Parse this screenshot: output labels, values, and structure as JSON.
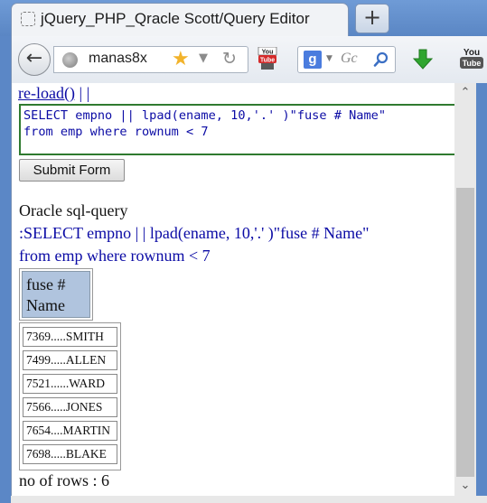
{
  "tab": {
    "title": "jQuery_PHP_Qracle Scott/Query Editor",
    "new_tab_label": "+"
  },
  "nav": {
    "url": "manas8x",
    "search_placeholder": "Gc",
    "back_icon": "back-arrow-icon",
    "search_engine_icon": "google-icon",
    "search_engine_letter": "g"
  },
  "page": {
    "reload_link": "re-load()",
    "reload_suffix": " | |",
    "query_line_1": "SELECT empno || lpad(ename, 10,'.' )\"fuse # Name\"",
    "query_line_2": "from emp where rownum < 7",
    "submit_label": "Submit Form",
    "heading": "Oracle sql-query",
    "echo_line_1": ":SELECT empno | | lpad(ename, 10,'.' )\"fuse # Name\"",
    "echo_line_2": "from emp where rownum < 7",
    "column_header_line_1": "fuse #",
    "column_header_line_2": "Name",
    "rows": [
      "7369.....SMITH",
      "7499.....ALLEN",
      "7521......WARD",
      "7566.....JONES",
      "7654....MARTIN",
      "7698.....BLAKE"
    ],
    "row_count_text": "no of rows : 6"
  },
  "colors": {
    "link_blue": "#0b0ba5",
    "header_fill": "#b0c4de",
    "query_border": "#2f7a2f"
  }
}
